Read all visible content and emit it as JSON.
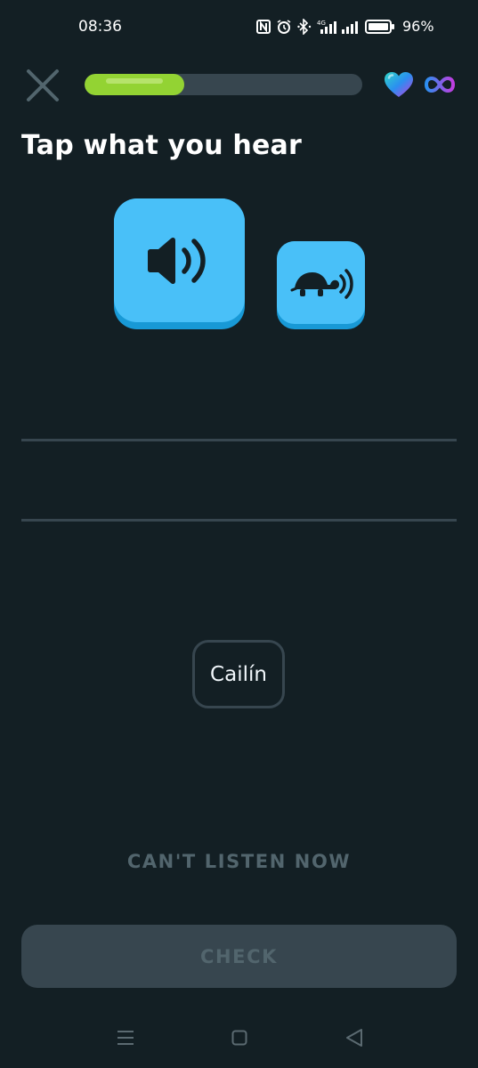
{
  "status_bar": {
    "time": "08:36",
    "network": "4G",
    "battery_percent": "96%"
  },
  "header": {
    "close_icon": "close-icon",
    "progress": 0.36,
    "hearts_icon": "heart-icon",
    "hearts_value": "infinity"
  },
  "exercise": {
    "title": "Tap what you hear",
    "speaker_icon": "speaker-icon",
    "slow_icon": "turtle-speaker-icon"
  },
  "word_bank": [
    "Cailín"
  ],
  "actions": {
    "cant_listen_label": "CAN'T LISTEN NOW",
    "check_label": "CHECK"
  },
  "colors": {
    "background": "#131f24",
    "accent_blue": "#49c0f8",
    "progress_green": "#93d333",
    "disabled_gray": "#37464f"
  }
}
